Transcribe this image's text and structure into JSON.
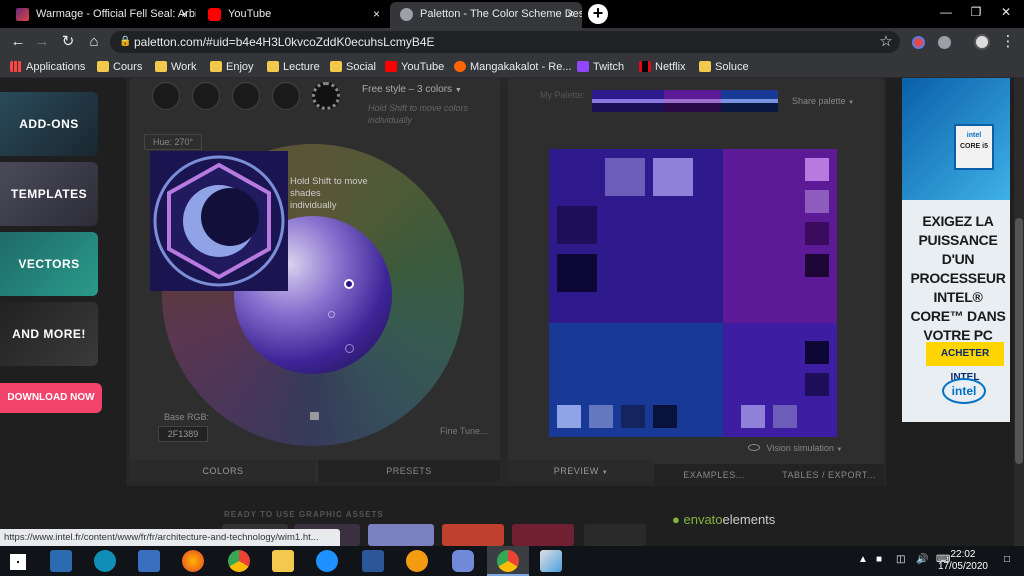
{
  "tabs": [
    {
      "title": "Warmage - Official Fell Seal: Arbi",
      "close": "×"
    },
    {
      "title": "YouTube",
      "close": "×"
    },
    {
      "title": "Paletton - The Color Scheme Des",
      "close": "×"
    }
  ],
  "new_tab": "+",
  "window_controls": {
    "minimize": "—",
    "restore": "❐",
    "close": "✕"
  },
  "nav": {
    "back": "←",
    "forward": "→",
    "reload": "↻",
    "home": "⌂",
    "lock": "🔒",
    "star": "☆",
    "menu": "⋮"
  },
  "address": "paletton.com/#uid=b4e4H3L0kvcoZddK0ecuhsLcmyB4E",
  "bookmarks": [
    {
      "label": "Applications",
      "icon": "apps-grid-icon"
    },
    {
      "label": "Cours",
      "icon": "folder-icon"
    },
    {
      "label": "Work",
      "icon": "folder-icon"
    },
    {
      "label": "Enjoy",
      "icon": "folder-icon"
    },
    {
      "label": "Lecture",
      "icon": "folder-icon"
    },
    {
      "label": "Social",
      "icon": "folder-icon"
    },
    {
      "label": "YouTube",
      "icon": "youtube-icon"
    },
    {
      "label": "Mangakakalot - Re...",
      "icon": "manga-icon"
    },
    {
      "label": "Twitch",
      "icon": "twitch-icon"
    },
    {
      "label": "Netflix",
      "icon": "netflix-icon"
    },
    {
      "label": "Soluce",
      "icon": "folder-icon"
    }
  ],
  "promo": {
    "items": [
      "ADD-ONS",
      "TEMPLATES",
      "VECTORS",
      "AND MORE!"
    ],
    "download": "DOWNLOAD NOW",
    "footer": "READY TO USE GRAPHIC ASSETS",
    "brand_a": "envato",
    "brand_b": "elements"
  },
  "paletton": {
    "mode": "Free style – 3 colors",
    "hint_top": "Hold Shift to move colors individually",
    "hue_label": "Hue: 270°",
    "hint_wheel": "Hold Shift to move shades individually",
    "base_rgb_label": "Base RGB:",
    "base_rgb_value": "2F1389",
    "fine_tune": "Fine Tune...",
    "tab_colors": "COLORS",
    "tab_presets": "PRESETS",
    "my_palette": "My Palette:",
    "share_palette": "Share palette",
    "vision_sim": "Vision simulation",
    "tab_preview": "PREVIEW",
    "tab_examples": "EXAMPLES...",
    "tab_tables": "TABLES / EXPORT..."
  },
  "ad": {
    "cpu_brand": "intel",
    "cpu_model": "CORE i5",
    "headline": "EXIGEZ LA PUISSANCE D'UN PROCESSEUR INTEL® CORE™ DANS VOTRE PC",
    "cta": "ACHETER INTEL",
    "logo": "intel"
  },
  "status_url": "https://www.intel.fr/content/www/fr/fr/architecture-and-technology/wim1.ht...",
  "clock": {
    "time": "22:02",
    "date": "17/05/2020"
  },
  "colors": {
    "base": "#2F1389",
    "secondary_a": "#5b1395",
    "secondary_b": "#13288c",
    "primary_rect": "#2e1a8c",
    "violet_rect": "#5d1a96",
    "blue_rect": "#183a96",
    "violet_blue_rect": "#3d1ea2"
  }
}
